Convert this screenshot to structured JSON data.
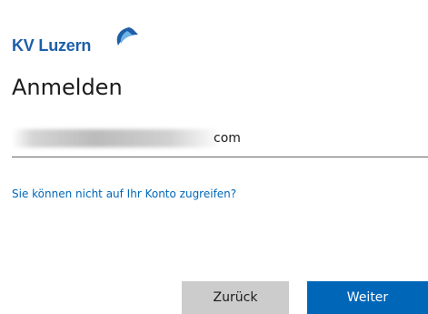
{
  "logo": {
    "text": "KV Luzern",
    "color": "#1e5fa8"
  },
  "title": "Anmelden",
  "email": {
    "visible_value": "com"
  },
  "links": {
    "cant_access": "Sie können nicht auf Ihr Konto zugreifen?"
  },
  "buttons": {
    "back_label": "Zurück",
    "next_label": "Weiter"
  },
  "colors": {
    "accent": "#0067b8",
    "secondary_button": "#cccccc",
    "text": "#1b1b1b"
  }
}
